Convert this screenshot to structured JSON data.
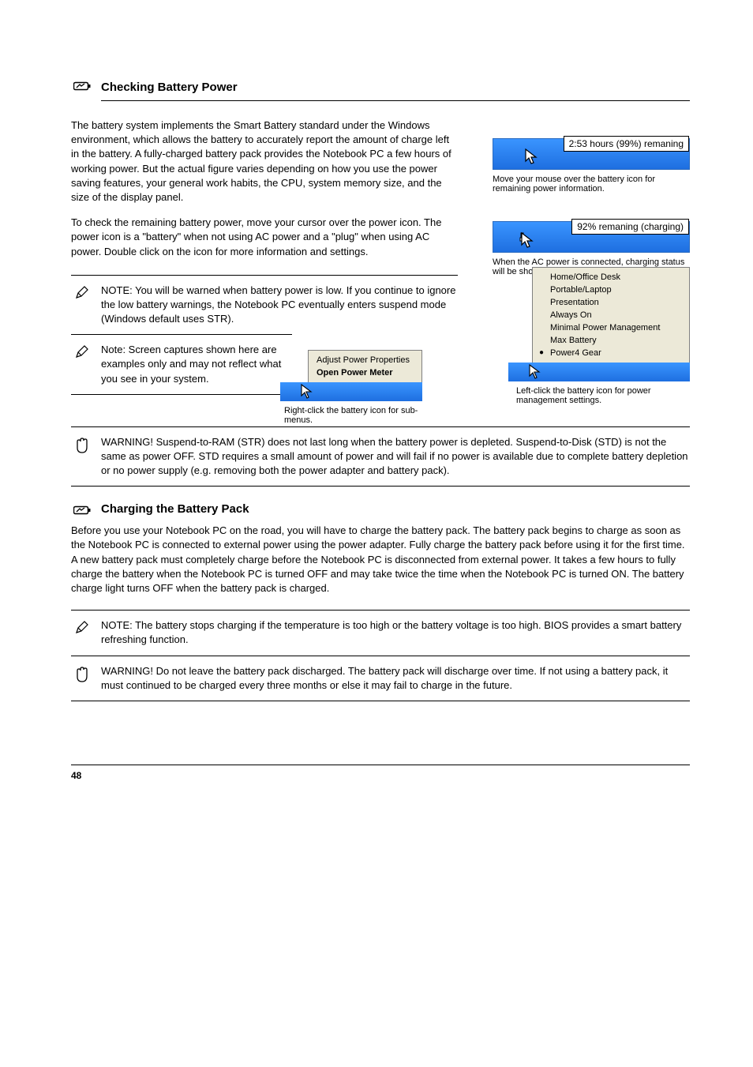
{
  "section": {
    "title": "Checking Battery Power",
    "icon_name": "battery-outline-icon"
  },
  "para1": "The battery system implements the Smart Battery standard under the Windows environment, which allows the battery to accurately report the amount of charge left in the battery. A fully-charged battery pack provides the Notebook PC a few hours of working power. But the actual figure varies depending on how you use the power saving features, your general work habits, the CPU, system memory size, and the size of the display panel.",
  "para2": "To check the remaining battery power, move your cursor over the power icon. The power icon is a \"battery\" when not using AC power and a \"plug\" when using AC power. Double click on the icon for more information and settings.",
  "tooltip1": "2:53 hours (99%) remaning",
  "tooltip1_caption": "Move your mouse over the battery icon for remaining power information.",
  "tooltip2": "92% remaning (charging)",
  "tooltip2_caption": "When the AC power is connected, charging status will be shown.",
  "note1": "NOTE: You will be warned when battery power is low. If you continue to ignore the low battery warnings, the Notebook PC eventually enters suspend mode (Windows default uses STR).",
  "note2": "Note: Screen captures shown here are examples only and may not reflect what you see in your system.",
  "context_menu": {
    "items": [
      {
        "label": "Adjust Power Properties",
        "bold": false
      },
      {
        "label": "Open Power Meter",
        "bold": true
      }
    ],
    "caption": "Right-click the battery icon for sub-menus."
  },
  "power_menu": {
    "items": [
      {
        "label": "Home/Office Desk",
        "selected": false
      },
      {
        "label": "Portable/Laptop",
        "selected": false
      },
      {
        "label": "Presentation",
        "selected": false
      },
      {
        "label": "Always On",
        "selected": false
      },
      {
        "label": "Minimal Power Management",
        "selected": false
      },
      {
        "label": "Max Battery",
        "selected": false
      },
      {
        "label": "Power4 Gear",
        "selected": true
      }
    ],
    "caption": "Left-click the battery icon for power management settings."
  },
  "warning": "WARNING!  Suspend-to-RAM (STR) does not last long when the battery power is depleted. Suspend-to-Disk (STD) is not the same as power OFF. STD requires a small amount of power and will fail if no power is available due to complete battery depletion or no power supply (e.g. removing both the power adapter and battery pack).",
  "charging": {
    "title": "Charging the Battery Pack",
    "body": "Before you use your Notebook PC on the road, you will have to charge the battery pack. The battery pack begins to charge as soon as the Notebook PC is connected to external power using the power adapter. Fully charge the battery pack before using it for the first time. A new battery pack must completely charge before the Notebook PC is disconnected from external power. It takes a few hours to fully charge the battery when the Notebook PC is turned OFF and may take twice the time when the Notebook PC is turned ON. The battery charge light turns OFF when the battery pack is charged."
  },
  "note3": "NOTE: The battery stops charging if the temperature is too high or the battery voltage is too high. BIOS provides a smart battery refreshing function.",
  "warning2": "WARNING!  Do not leave the battery pack discharged. The battery pack will discharge over time. If not using a battery pack, it must continued to be charged every three months or else it may fail to charge in the future.",
  "footer": {
    "page": "48"
  }
}
